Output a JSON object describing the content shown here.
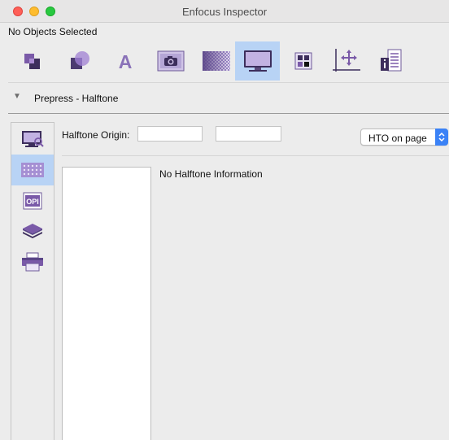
{
  "window": {
    "title": "Enfocus Inspector"
  },
  "selection_status": "No Objects Selected",
  "toolbar": {
    "items": [
      {
        "name": "objects-icon"
      },
      {
        "name": "fill-stroke-icon"
      },
      {
        "name": "text-icon",
        "glyph": "A"
      },
      {
        "name": "image-icon"
      },
      {
        "name": "transparency-icon"
      },
      {
        "name": "prepress-icon",
        "active": true
      },
      {
        "name": "color-icon"
      },
      {
        "name": "position-icon"
      },
      {
        "name": "document-info-icon"
      }
    ]
  },
  "section": {
    "title": "Prepress - Halftone",
    "expanded": true
  },
  "side_tabs": [
    {
      "name": "display-icon"
    },
    {
      "name": "halftone-icon",
      "active": true
    },
    {
      "name": "opi-icon",
      "glyph": "OPI"
    },
    {
      "name": "layers-icon"
    },
    {
      "name": "print-icon"
    }
  ],
  "halftone": {
    "origin_label": "Halftone Origin:",
    "origin_x": "",
    "origin_y": "",
    "mode_selected": "HTO on page",
    "empty_message": "No Halftone Information"
  },
  "colors": {
    "accent": "#3b82f6",
    "selected_bg": "#b8d3f5",
    "icon_purple": "#7a5aa8"
  }
}
